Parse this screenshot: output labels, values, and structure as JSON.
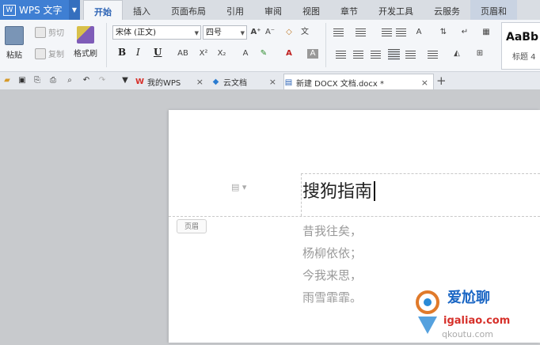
{
  "app": {
    "name": "WPS 文字"
  },
  "menu": {
    "tabs": [
      "开始",
      "插入",
      "页面布局",
      "引用",
      "审阅",
      "视图",
      "章节",
      "开发工具",
      "云服务",
      "页眉和"
    ],
    "active": 0
  },
  "ribbon": {
    "paste_label": "粘贴",
    "cut_label": "剪切",
    "copy_label": "复制",
    "format_painter_label": "格式刷",
    "font_name": "宋体 (正文)",
    "font_size": "四号",
    "style_preview": "AaBb",
    "style_name": "标题 4"
  },
  "doc_tabs": [
    {
      "label": "我的WPS",
      "active": false
    },
    {
      "label": "云文档",
      "active": false
    },
    {
      "label": "新建 DOCX 文档.docx *",
      "active": true
    }
  ],
  "document": {
    "header_text": "搜狗指南",
    "header_label": "页眉",
    "poem_lines": [
      "昔我往矣，",
      "杨柳依依；",
      "今我来思，",
      "雨雪霏霏。"
    ]
  },
  "watermark": {
    "brand_text": "爱尬聊",
    "url_text": "igaliao.com",
    "partial_text": "qkoutu.com"
  },
  "colors": {
    "app_blue": "#3f7fd3",
    "active_tab_text": "#2b62b4",
    "wps_red": "#d6302a"
  }
}
